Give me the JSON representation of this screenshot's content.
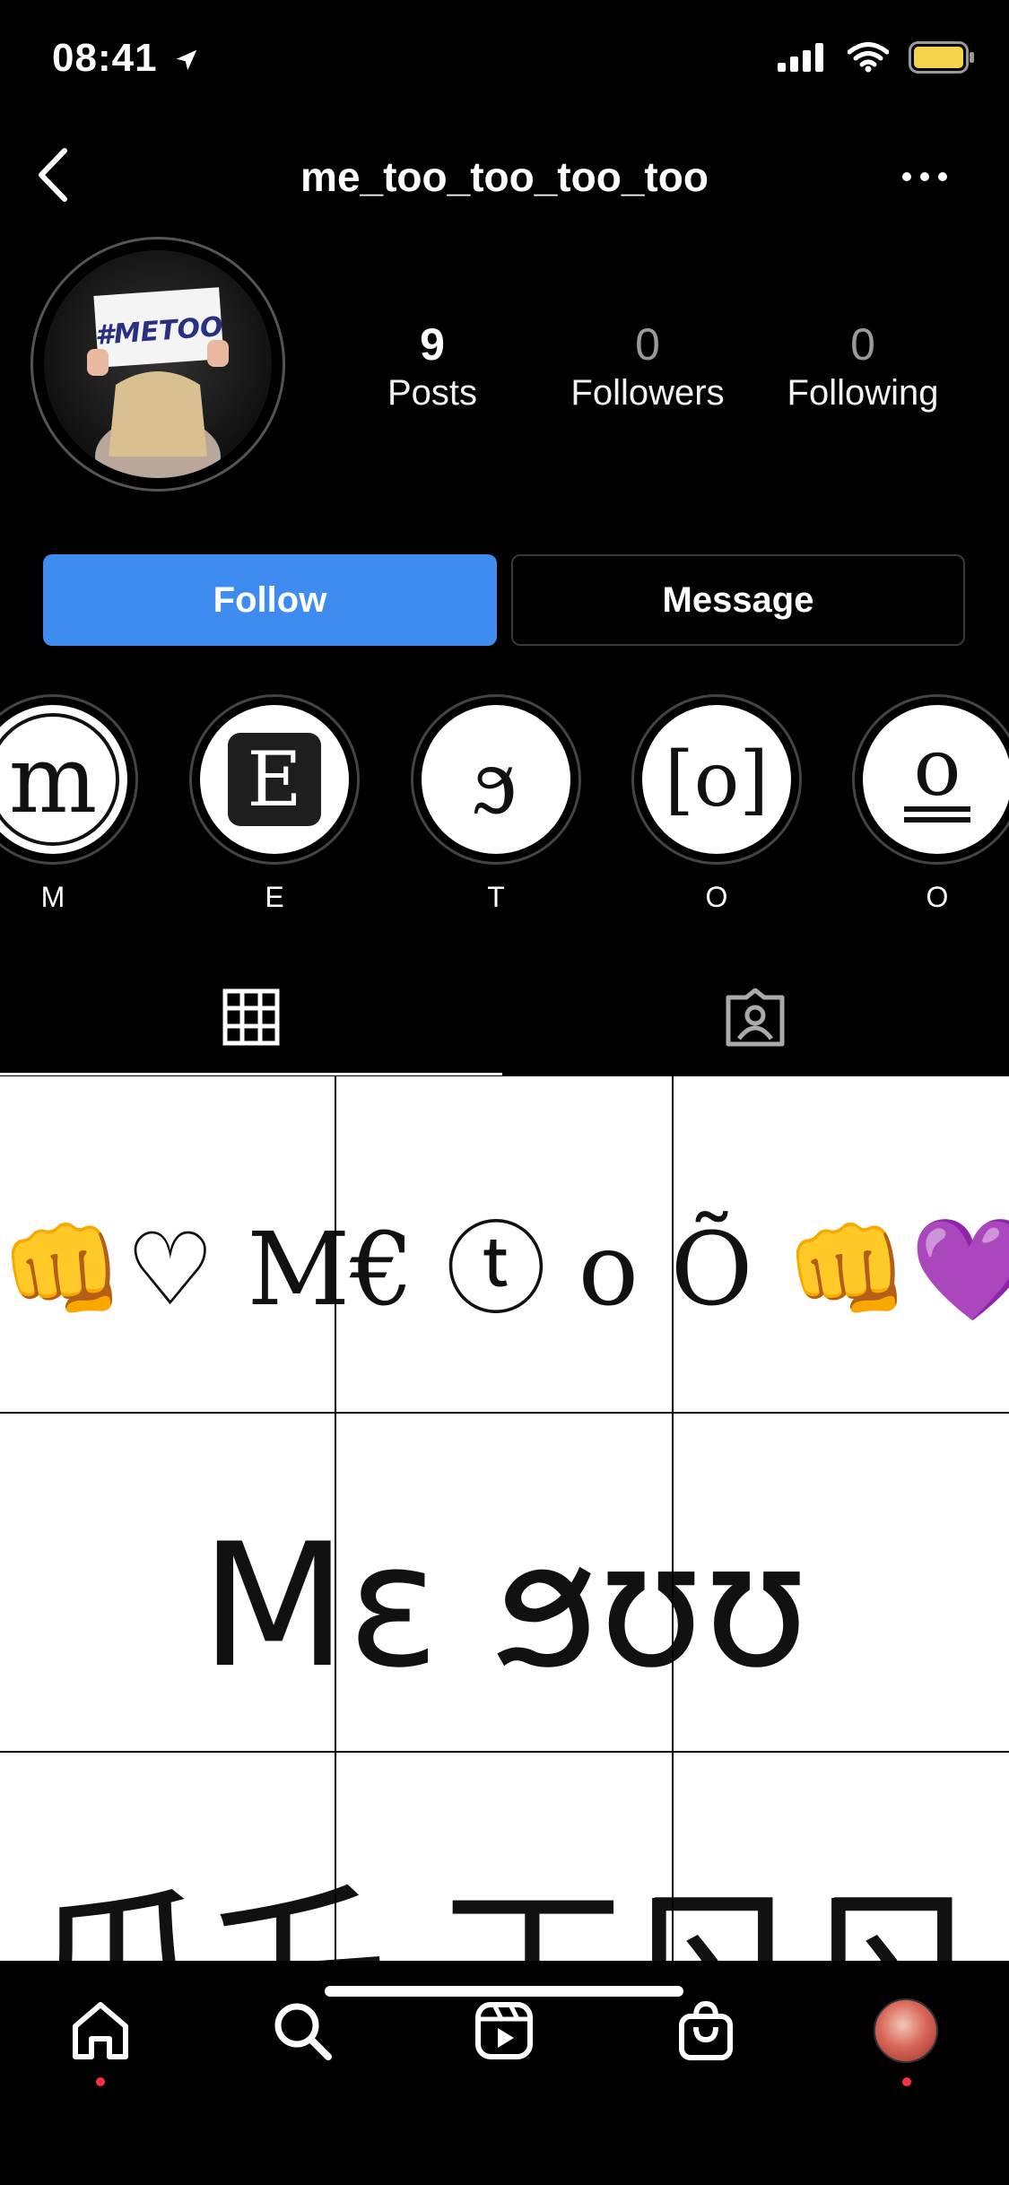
{
  "status_bar": {
    "time": "08:41"
  },
  "header": {
    "username": "me_too_too_too_too"
  },
  "profile": {
    "avatar_sign_text": "#METOO",
    "stats": [
      {
        "value": "9",
        "label": "Posts"
      },
      {
        "value": "0",
        "label": "Followers"
      },
      {
        "value": "0",
        "label": "Following"
      }
    ]
  },
  "actions": {
    "follow_label": "Follow",
    "message_label": "Message"
  },
  "highlights": [
    {
      "glyph": "m",
      "label": "M"
    },
    {
      "glyph": "E",
      "label": "E"
    },
    {
      "glyph": "ϧ",
      "label": "T"
    },
    {
      "glyph": "[o]",
      "label": "O"
    },
    {
      "glyph": "o",
      "label": "O"
    }
  ],
  "posts_grid": {
    "rows": [
      {
        "text": "👊♡  M€ ⓣ o Õ  👊💜"
      },
      {
        "text": "Mɛ ϧʊʊ"
      },
      {
        "text": "爪乇 丅ㄖㄖ"
      }
    ]
  },
  "colors": {
    "follow_blue": "#3f8cf0",
    "notification_red": "#ff3040"
  },
  "icons": {
    "header": [
      "back-chevron-icon",
      "more-options-icon"
    ],
    "tabs": [
      "grid-icon",
      "tagged-icon"
    ],
    "nav": [
      "home-icon",
      "search-icon",
      "reels-icon",
      "shop-icon",
      "profile-avatar-icon"
    ]
  }
}
